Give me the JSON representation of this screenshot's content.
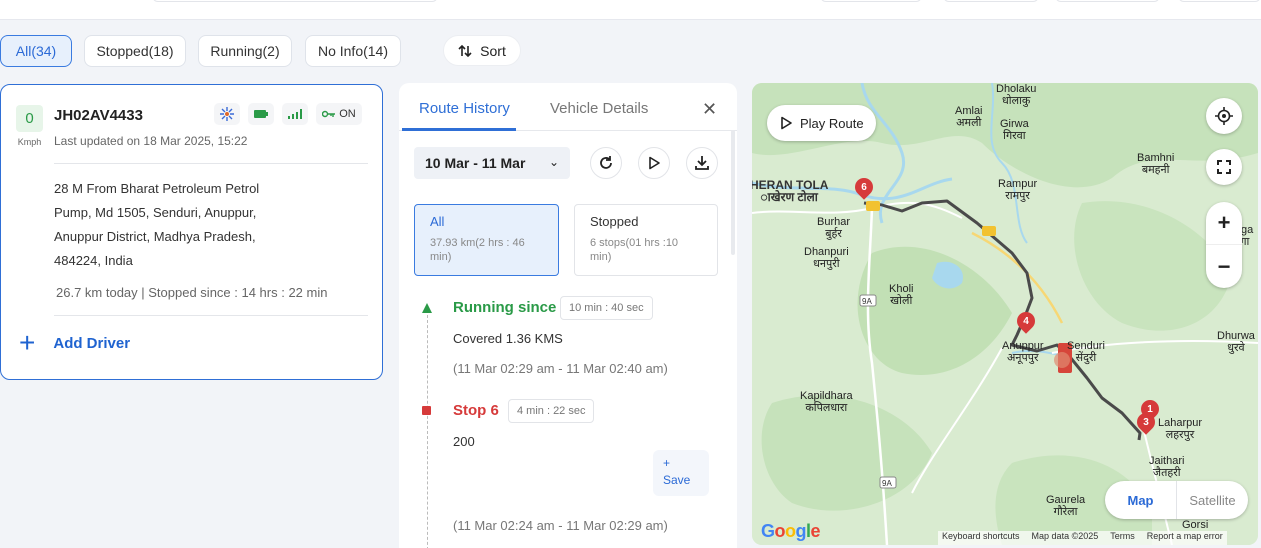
{
  "filters": {
    "all": "All(34)",
    "stopped": "Stopped(18)",
    "running": "Running(2)",
    "no_info": "No Info(14)",
    "sort": "Sort"
  },
  "vehicle": {
    "speed": "0",
    "speed_unit": "Kmph",
    "plate": "JH02AV4433",
    "updated": "Last updated on 18 Mar 2025, 15:22",
    "ignition": "ON",
    "address_lines": [
      "28 M From Bharat Petroleum Petrol",
      "Pump, Md 1505, Senduri, Anuppur,",
      "Anuppur District, Madhya Pradesh,",
      "484224, India"
    ],
    "km_today": "26.7 km today | Stopped since : 14 hrs : 22 min",
    "add_driver": "Add Driver"
  },
  "route_panel": {
    "tabs": [
      "Route History",
      "Vehicle Details"
    ],
    "date_range": "10 Mar - 11 Mar",
    "segments": {
      "all_title": "All",
      "all_sub": "37.93 km(2 hrs : 46 min)",
      "stopped_title": "Stopped",
      "stopped_sub": "6 stops(01 hrs :10 min)"
    },
    "events": [
      {
        "title": "Running since",
        "duration": "10 min : 40 sec",
        "text": "Covered 1.36 KMS",
        "time": "(11 Mar 02:29 am - 11 Mar 02:40 am)"
      },
      {
        "title": "Stop 6",
        "duration": "4 min : 22 sec",
        "text": "200",
        "time": "(11 Mar 02:24 am - 11 Mar 02:29 am)"
      }
    ],
    "save_plus": "+",
    "save_label": "Save"
  },
  "map": {
    "play_route": "Play Route",
    "map_type": [
      "Map",
      "Satellite"
    ],
    "google": "Google",
    "attribution": [
      "Keyboard shortcuts",
      "Map data ©2025",
      "Terms",
      "Report a map error"
    ],
    "places": {
      "dholakpur": "Dholaku\nधोलाकु",
      "amlai": "Amlai\nअमली",
      "girwa": "Girwa\nगिरवा",
      "bamhni": "Bamhni\nबमहनी",
      "heran_tola": "HERAN TOLA\nाखेरण टोला",
      "rampur": "Rampur\nरामपुर",
      "burhar": "Burhar\nबुर्हर",
      "dhanpuri": "Dhanpuri\nधनपुरी",
      "funga": "Funga\nफुनगा",
      "kholi": "Kholi\nखोली",
      "anuppur": "Anuppur\nअनूपपुर",
      "senduri": "Senduri\nसेंदुरी",
      "dhurwa": "Dhurwa\nधुरवे",
      "kapildhara": "Kapildhara\nकपिलधारा",
      "laharpur": "Laharpur\nलहरपुर",
      "jaithari": "Jaithari\nजैतहरी",
      "gaurela": "Gaurela\nगौरेला",
      "gorsi": "Gorsi"
    },
    "route_badges": [
      "9A",
      "9A",
      "9A"
    ],
    "pins": [
      "6",
      "4",
      "3",
      "1"
    ],
    "colors": {
      "land": "#d9ebd0",
      "forest": "#bfe0b3",
      "water": "#a8d8ee",
      "route": "#4a4a4a",
      "pin": "#d63a3a"
    }
  }
}
